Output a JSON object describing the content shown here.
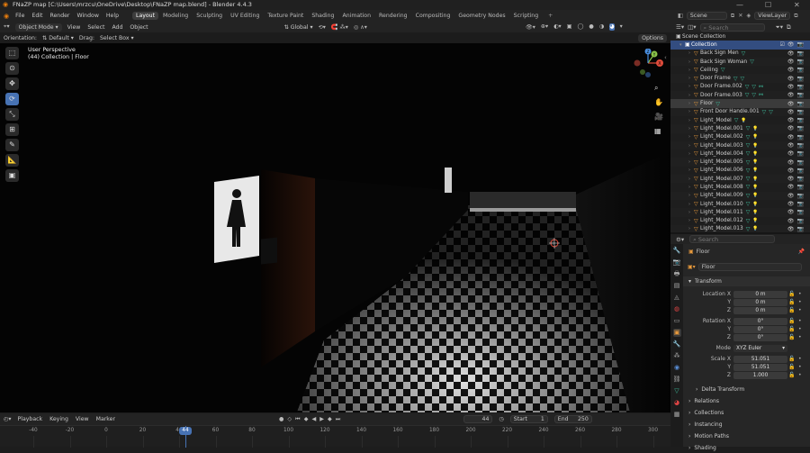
{
  "window": {
    "title": "FNaZP map [C:\\Users\\mrzcu\\OneDrive\\Desktop\\FNaZP map.blend] - Blender 4.4.3"
  },
  "menubar": {
    "items": [
      "File",
      "Edit",
      "Render",
      "Window",
      "Help"
    ],
    "workspaces": [
      "Layout",
      "Modeling",
      "Sculpting",
      "UV Editing",
      "Texture Paint",
      "Shading",
      "Animation",
      "Rendering",
      "Compositing",
      "Geometry Nodes",
      "Scripting"
    ],
    "active_workspace": "Layout",
    "add_tab": "+"
  },
  "scene": {
    "scene_name": "Scene",
    "view_layer": "ViewLayer"
  },
  "viewport_header": {
    "mode": "Object Mode",
    "menus": [
      "View",
      "Select",
      "Add",
      "Object"
    ],
    "transform_orientation": "Global",
    "options": "Options"
  },
  "viewport_header2": {
    "orientation_label": "Orientation:",
    "orientation_value": "Default",
    "drag_label": "Drag:",
    "drag_value": "Select Box"
  },
  "viewport": {
    "perspective": "User Perspective",
    "collection_info": "(44) Collection | Floor",
    "sign_icon": "woman-restroom-icon",
    "gizmo": {
      "x": "X",
      "y": "Y",
      "z": "Z"
    }
  },
  "toolbar": {
    "tools": [
      "select-box",
      "cursor",
      "move",
      "rotate",
      "scale",
      "transform",
      "annotate",
      "measure",
      "add-cube"
    ],
    "active": "rotate"
  },
  "timeline": {
    "menus": [
      "Playback",
      "Keying",
      "View",
      "Marker"
    ],
    "current_frame": "44",
    "start_label": "Start",
    "start": "1",
    "end_label": "End",
    "end": "250",
    "ticks": [
      "-40",
      "-20",
      "0",
      "20",
      "40",
      "60",
      "80",
      "100",
      "120",
      "140",
      "160",
      "180",
      "200",
      "220",
      "240",
      "260",
      "280",
      "300"
    ],
    "playhead": "44"
  },
  "outliner": {
    "search_placeholder": "Search",
    "root": "Scene Collection",
    "collection": "Collection",
    "items": [
      "Back Sign Men",
      "Back Sign Woman",
      "Ceiling",
      "Door Frame",
      "Door Frame.002",
      "Door Frame.003",
      "Floor",
      "Front Door Handle.001",
      "Light_Model",
      "Light_Model.001",
      "Light_Model.002",
      "Light_Model.003",
      "Light_Model.004",
      "Light_Model.005",
      "Light_Model.006",
      "Light_Model.007",
      "Light_Model.008",
      "Light_Model.009",
      "Light_Model.010",
      "Light_Model.011",
      "Light_Model.012",
      "Light_Model.013"
    ]
  },
  "properties": {
    "search_placeholder": "Search",
    "object_name": "Floor",
    "datablock_name": "Floor",
    "transform_label": "Transform",
    "location_label": "Location X",
    "loc": [
      "0 m",
      "0 m",
      "0 m"
    ],
    "rotation_label": "Rotation X",
    "rot": [
      "0°",
      "0°",
      "0°"
    ],
    "mode_label": "Mode",
    "mode_value": "XYZ Euler",
    "scale_label": "Scale X",
    "scale": [
      "51.051",
      "51.051",
      "1.000"
    ],
    "axis_y": "Y",
    "axis_z": "Z",
    "sections": [
      "Delta Transform",
      "Relations",
      "Collections",
      "Instancing",
      "Motion Paths",
      "Shading"
    ]
  }
}
